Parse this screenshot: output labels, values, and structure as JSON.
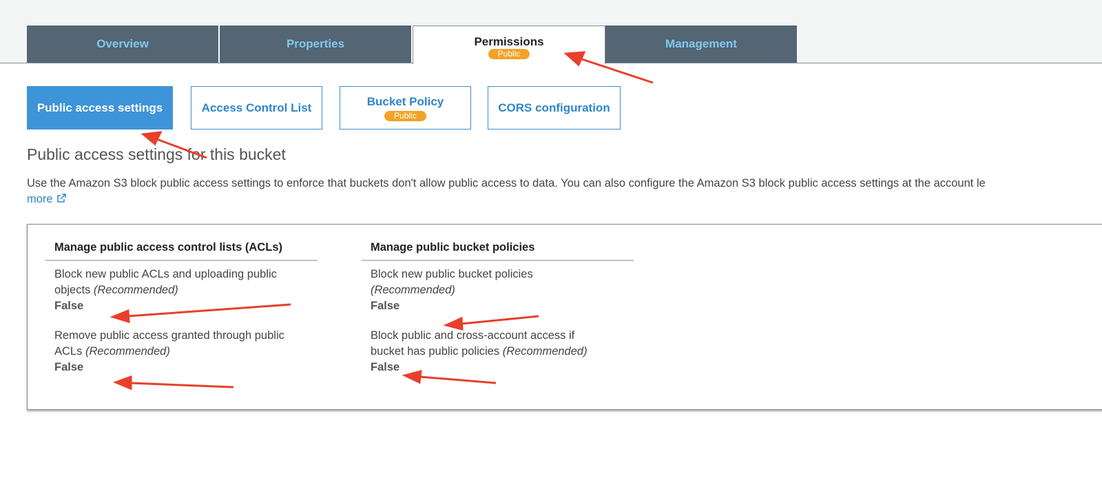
{
  "tabs": [
    {
      "label": "Overview"
    },
    {
      "label": "Properties"
    },
    {
      "label": "Permissions",
      "badge": "Public"
    },
    {
      "label": "Management"
    }
  ],
  "subtabs": [
    {
      "label": "Public access settings"
    },
    {
      "label": "Access Control List"
    },
    {
      "label": "Bucket Policy",
      "badge": "Public"
    },
    {
      "label": "CORS configuration"
    }
  ],
  "section": {
    "heading": "Public access settings for this bucket",
    "description": "Use the Amazon S3 block public access settings to enforce that buckets don't allow public access to data. You can also configure the Amazon S3 block public access settings at the account le",
    "learn_more": "more"
  },
  "acls": {
    "title": "Manage public access control lists (ACLs)",
    "settings": [
      {
        "line1": "Block new public ACLs and uploading public",
        "line2": "objects",
        "rec": "(Recommended)",
        "value": "False"
      },
      {
        "line1": "Remove public access granted through public",
        "line2": "ACLs",
        "rec": "(Recommended)",
        "value": "False"
      }
    ]
  },
  "policies": {
    "title": "Manage public bucket policies",
    "settings": [
      {
        "line1": "Block new public bucket policies",
        "line2": "",
        "rec": "(Recommended)",
        "value": "False"
      },
      {
        "line1": "Block public and cross-account access if",
        "line2": "bucket has public policies",
        "rec": "(Recommended)",
        "value": "False"
      }
    ]
  },
  "colors": {
    "tab_bg": "#546574",
    "tab_text": "#7fc9f0",
    "accent_blue": "#3e94d8",
    "badge_orange": "#f2a327",
    "annotation_red": "#e8402a"
  }
}
